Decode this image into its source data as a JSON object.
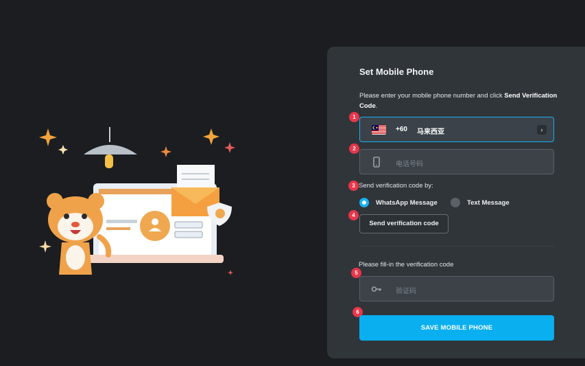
{
  "form": {
    "title": "Set Mobile Phone",
    "description_prefix": "Please enter your mobile phone number and click ",
    "description_bold": "Send Verification Code",
    "description_suffix": ".",
    "country": {
      "flag_icon": "malaysia-flag-icon",
      "dial_code": "+60",
      "name": "马来西亚"
    },
    "phone_placeholder": "电话号码",
    "send_via_label": "Send verification code by:",
    "options": [
      {
        "label": "WhatsApp Message",
        "selected": true
      },
      {
        "label": "Text Message",
        "selected": false
      }
    ],
    "send_button": "Send verification code",
    "fill_label": "Please fill-in the verification code",
    "code_placeholder": "验证码",
    "save_button": "SAVE MOBILE PHONE"
  },
  "badges": [
    "1",
    "2",
    "3",
    "4",
    "5",
    "6"
  ],
  "colors": {
    "accent": "#0aaff0",
    "badge": "#e8364a",
    "panel": "#30353a",
    "background": "#1b1d21"
  }
}
